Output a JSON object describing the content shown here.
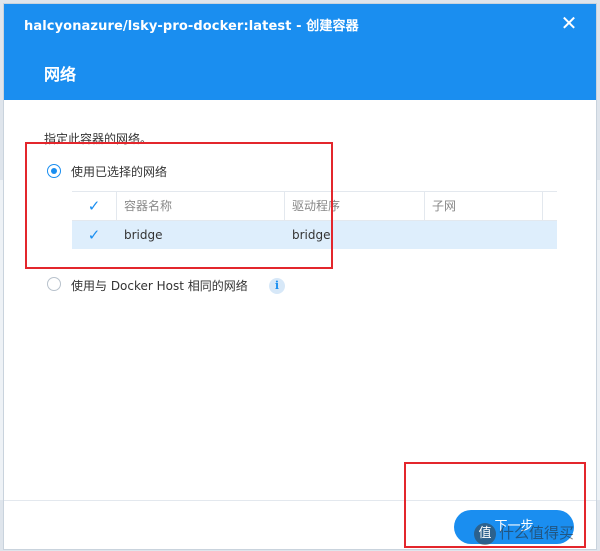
{
  "window": {
    "title": "halcyonazure/lsky-pro-docker:latest - 创建容器",
    "close_glyph": "✕"
  },
  "step": {
    "title": "网络",
    "description": "指定此容器的网络。"
  },
  "options": {
    "selected_network_label": "使用已选择的网络",
    "host_network_label": "使用与 Docker Host 相同的网络",
    "info_glyph": "i"
  },
  "network_table": {
    "columns": [
      "容器名称",
      "驱动程序",
      "子网"
    ],
    "rows": [
      {
        "checked": true,
        "name": "bridge",
        "driver": "bridge",
        "subnet": ""
      }
    ]
  },
  "footer": {
    "next_label": "下一步"
  },
  "watermark": {
    "badge": "值",
    "text": "什么值得买"
  },
  "colors": {
    "accent": "#1a8ef0",
    "highlight_row": "#deeefc",
    "annotation_red": "#e3262c"
  },
  "icons": {
    "close": "close-icon",
    "check": "checkmark-icon",
    "info": "info-icon"
  }
}
